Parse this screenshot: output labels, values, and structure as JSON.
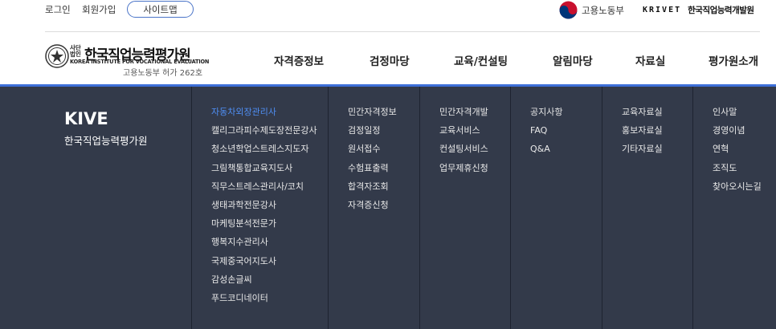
{
  "topbar": {
    "login": "로그인",
    "signup": "회원가입",
    "sitemap": "사이트맵",
    "ministry": "고용노동부",
    "krivet_en": "KRIVET",
    "krivet_ko": "한국직업능력개발원"
  },
  "logo": {
    "small": "사단법인",
    "name": "한국직업능력평가원",
    "english": "KOREA INSTITUTE FOR VOCATIONAL EVALUATION",
    "permit": "고용노동부 허가 262호"
  },
  "gnb": [
    "자격증정보",
    "검정마당",
    "교육/컨설팅",
    "알림마당",
    "자료실",
    "평가원소개"
  ],
  "mega": {
    "title": "KIVE",
    "subtitle": "한국직업능력평가원",
    "columns": [
      {
        "items": [
          "자동차외장관리사",
          "캘리그라피수제도장전문강사",
          "청소년학업스트레스지도자",
          "그림책통합교육지도사",
          "직무스트레스관리사/코치",
          "생태과학전문강사",
          "마케팅분석전문가",
          "행복지수관리사",
          "국제중국어지도사",
          "감성손글씨",
          "푸드코디네이터"
        ],
        "active_index": 0
      },
      {
        "items": [
          "민간자격정보",
          "검정일정",
          "원서접수",
          "수험표출력",
          "합격자조회",
          "자격증신청"
        ]
      },
      {
        "items": [
          "민간자격개발",
          "교육서비스",
          "컨설팅서비스",
          "업무제휴신청"
        ]
      },
      {
        "items": [
          "공지사항",
          "FAQ",
          "Q&A"
        ]
      },
      {
        "items": [
          "교육자료실",
          "홍보자료실",
          "기타자료실"
        ]
      },
      {
        "items": [
          "인사말",
          "경영이념",
          "연혁",
          "조직도",
          "찾아오시는길"
        ]
      }
    ]
  },
  "colors": {
    "accent_line": "#3d6fd8",
    "mega_bg": "#333a4a",
    "active_item": "#4f8ff5",
    "sitemap_border": "#4a74c8"
  }
}
